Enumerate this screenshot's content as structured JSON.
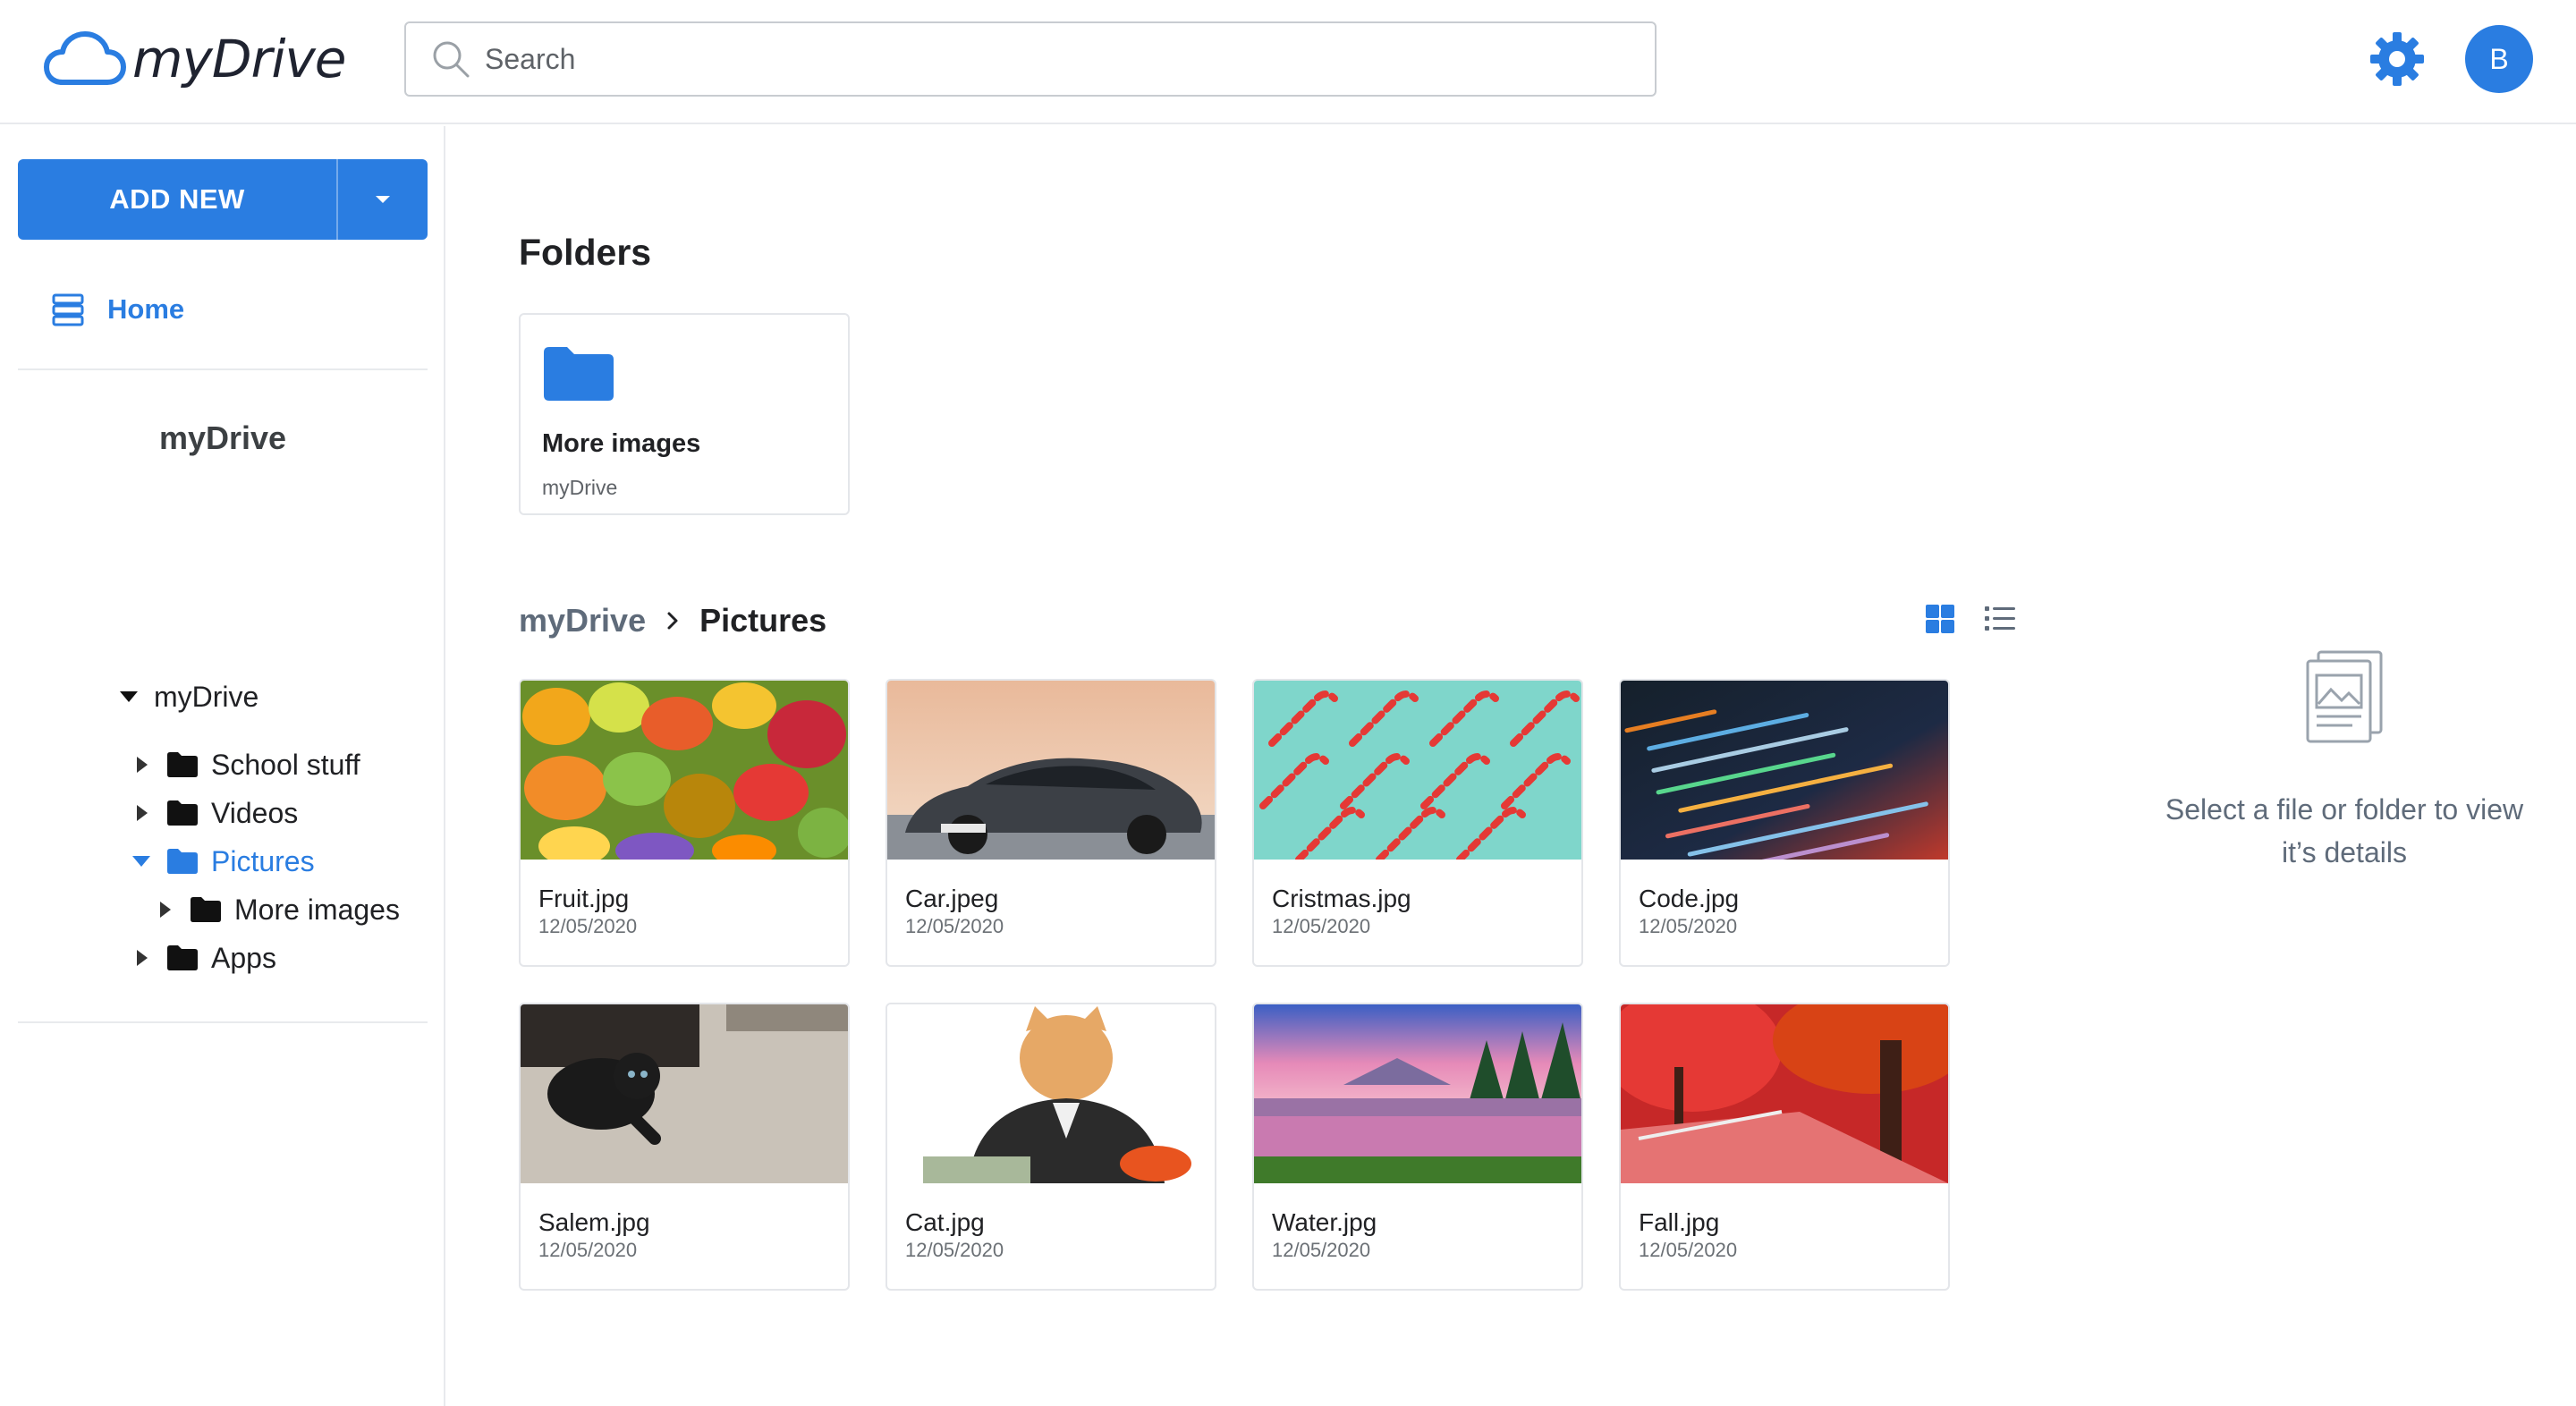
{
  "app": {
    "name": "myDrive",
    "brand_color": "#2a7de1"
  },
  "search": {
    "placeholder": "Search",
    "value": ""
  },
  "user": {
    "avatar_letter": "B"
  },
  "sidebar": {
    "add_new_label": "ADD NEW",
    "home_label": "Home",
    "heading": "myDrive",
    "tree": [
      {
        "label": "myDrive",
        "expanded": true
      },
      {
        "label": "School stuff",
        "expanded": false
      },
      {
        "label": "Videos",
        "expanded": false
      },
      {
        "label": "Pictures",
        "expanded": true,
        "active": true
      },
      {
        "label": "More images",
        "expanded": false
      },
      {
        "label": "Apps",
        "expanded": false
      }
    ]
  },
  "main": {
    "folders_title": "Folders",
    "folders": [
      {
        "name": "More images",
        "location": "myDrive"
      }
    ],
    "breadcrumb": {
      "root": "myDrive",
      "current": "Pictures"
    },
    "files": [
      {
        "name": "Fruit.jpg",
        "date": "12/05/2020",
        "thumb": "fruit"
      },
      {
        "name": "Car.jpeg",
        "date": "12/05/2020",
        "thumb": "car"
      },
      {
        "name": "Cristmas.jpg",
        "date": "12/05/2020",
        "thumb": "candy-canes"
      },
      {
        "name": "Code.jpg",
        "date": "12/05/2020",
        "thumb": "code"
      },
      {
        "name": "Salem.jpg",
        "date": "12/05/2020",
        "thumb": "black-kitten"
      },
      {
        "name": "Cat.jpg",
        "date": "12/05/2020",
        "thumb": "cat-with-money"
      },
      {
        "name": "Water.jpg",
        "date": "12/05/2020",
        "thumb": "mountain-lake"
      },
      {
        "name": "Fall.jpg",
        "date": "12/05/2020",
        "thumb": "autumn-trees"
      }
    ]
  },
  "details": {
    "empty_line1": "Select a file or folder to view",
    "empty_line2": "it’s details"
  }
}
